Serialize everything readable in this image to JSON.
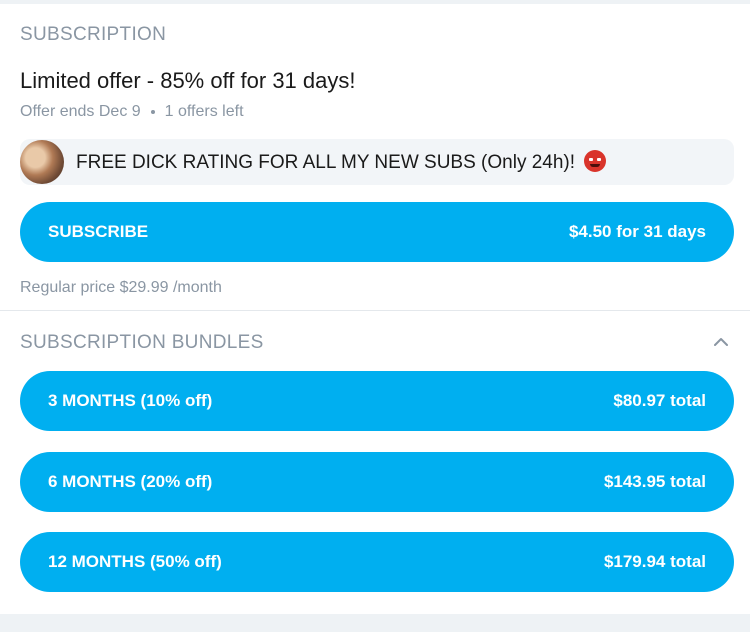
{
  "subscription": {
    "section_title": "SUBSCRIPTION",
    "offer_title": "Limited offer - 85% off for 31 days!",
    "offer_ends": "Offer ends Dec 9",
    "offers_left": "1 offers left",
    "message_text": "FREE DICK RATING FOR ALL MY NEW SUBS (Only 24h)!",
    "message_emoji_icon": "smiling-devil-icon",
    "subscribe_button": {
      "label": "SUBSCRIBE",
      "price": "$4.50 for 31 days"
    },
    "regular_price": "Regular price $29.99 /month"
  },
  "bundles": {
    "section_title": "SUBSCRIPTION BUNDLES",
    "collapse_icon": "chevron-up-icon",
    "items": [
      {
        "label": "3 MONTHS (10% off)",
        "price": "$80.97 total"
      },
      {
        "label": "6 MONTHS (20% off)",
        "price": "$143.95 total"
      },
      {
        "label": "12 MONTHS (50% off)",
        "price": "$179.94 total"
      }
    ]
  },
  "colors": {
    "accent": "#00aff0",
    "muted_text": "#8a96a3",
    "message_bg": "#f2f5f8"
  }
}
